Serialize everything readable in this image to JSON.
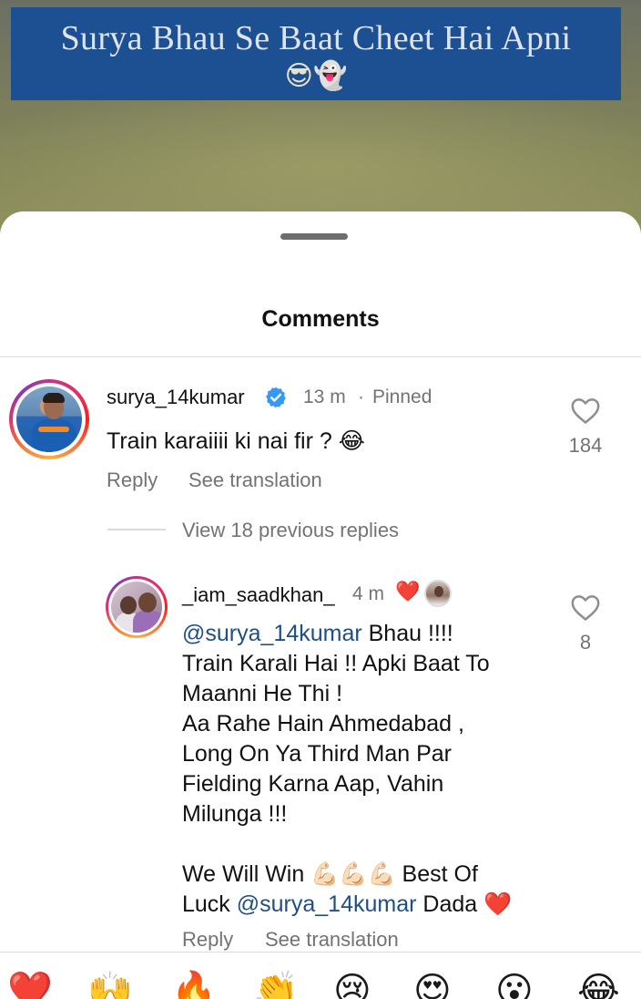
{
  "video": {
    "caption": "Surya Bhau Se Baat Cheet Hai Apni",
    "caption_emojis": "😎👻"
  },
  "sheet": {
    "title": "Comments"
  },
  "comments": [
    {
      "username": "surya_14kumar",
      "verified": true,
      "time": "13 m",
      "separator": "·",
      "pinned_label": "Pinned",
      "text": "Train karaiiii ki nai fir ? 😂",
      "like_count": "184",
      "reply_label": "Reply",
      "translate_label": "See translation"
    }
  ],
  "view_replies_label": "View 18 previous replies",
  "reply": {
    "username": "_iam_saadkhan_",
    "time": "4 m",
    "heart": "❤️",
    "mention": "@surya_14kumar",
    "line1_rest": " Bhau !!!!",
    "line2": "Train Karali Hai !! Apki Baat To",
    "line3": "Maanni He Thi !",
    "line4": "Aa Rahe Hain Ahmedabad ,",
    "line5": "Long On Ya Third Man Par",
    "line6": "Fielding Karna Aap, Vahin",
    "line7": "Milunga !!!",
    "line8": "We Will Win 💪🏻💪🏻💪🏻 Best Of",
    "line9_start": "Luck ",
    "line9_mention": "@surya_14kumar",
    "line9_end": " Dada ❤️",
    "like_count": "8",
    "reply_label": "Reply",
    "translate_label": "See translation"
  },
  "reactions": [
    "❤️",
    "🙌",
    "🔥",
    "👏",
    "😢",
    "😍",
    "😮",
    "😂"
  ],
  "colors": {
    "caption_bg": "#1d4f93",
    "mention": "#1f4e87",
    "verified": "#3897f0",
    "muted": "#737373"
  }
}
